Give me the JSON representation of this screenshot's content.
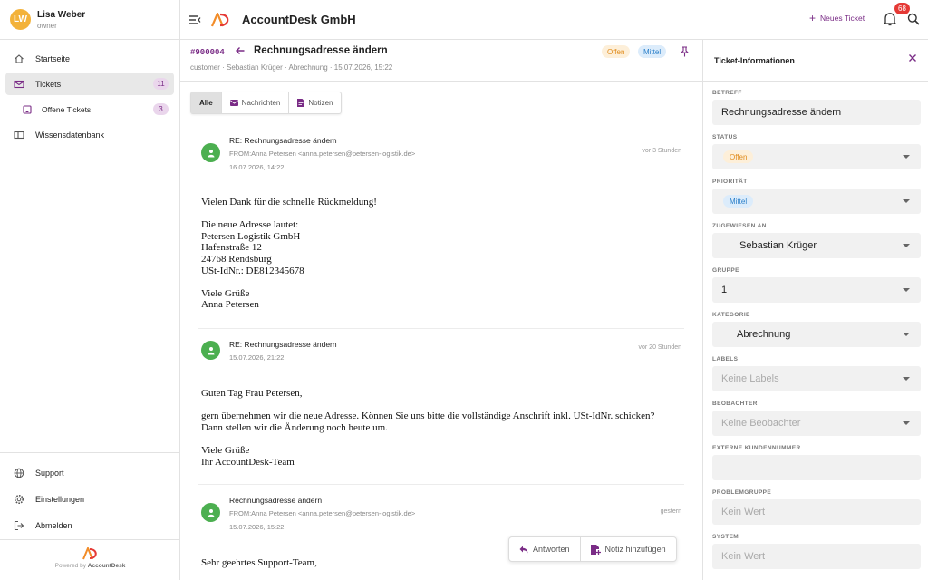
{
  "user": {
    "initials": "LW",
    "name": "Lisa Weber",
    "role": "owner"
  },
  "nav": {
    "home": "Startseite",
    "tickets": "Tickets",
    "tickets_count": "11",
    "open_tickets": "Offene Tickets",
    "open_tickets_count": "3",
    "knowledge": "Wissensdatenbank",
    "support": "Support",
    "settings": "Einstellungen",
    "logout": "Abmelden"
  },
  "powered_by": {
    "prefix": "Powered by",
    "brand": "AccountDesk"
  },
  "topbar": {
    "company": "AccountDesk GmbH",
    "new_ticket": "Neues Ticket",
    "notification_count": "68"
  },
  "ticket": {
    "id": "#900004",
    "title": "Rechnungsadresse ändern",
    "meta": "customer · Sebastian Krüger · Abrechnung · 15.07.2026, 15:22",
    "status": "Offen",
    "priority": "Mittel"
  },
  "tabs": {
    "all": "Alle",
    "messages": "Nachrichten",
    "notes": "Notizen"
  },
  "messages": [
    {
      "subject": "RE: Rechnungsadresse ändern",
      "from": "FROM:Anna Petersen <anna.petersen@petersen-logistik.de>",
      "date": "16.07.2026, 14:22",
      "ago": "vor 3 Stunden",
      "body": "Vielen Dank für die schnelle Rückmeldung!\n\nDie neue Adresse lautet:\nPetersen Logistik GmbH\nHafenstraße 12\n24768 Rendsburg\nUSt-IdNr.: DE812345678\n\nViele Grüße\nAnna Petersen"
    },
    {
      "subject": "RE: Rechnungsadresse ändern",
      "from": "",
      "date": "15.07.2026, 21:22",
      "ago": "vor 20 Stunden",
      "body": "Guten Tag Frau Petersen,\n\ngern übernehmen wir die neue Adresse. Können Sie uns bitte die vollständige Anschrift inkl. USt-IdNr. schicken?\nDann stellen wir die Änderung noch heute um.\n\nViele Grüße\nIhr AccountDesk-Team"
    },
    {
      "subject": "Rechnungsadresse ändern",
      "from": "FROM:Anna Petersen <anna.petersen@petersen-logistik.de>",
      "date": "15.07.2026, 15:22",
      "ago": "gestern",
      "body": "Sehr geehrtes Support-Team,"
    }
  ],
  "actions": {
    "reply": "Antworten",
    "add_note": "Notiz hinzufügen"
  },
  "panel": {
    "title": "Ticket-Informationen",
    "subject_label": "BETREFF",
    "subject_value": "Rechnungsadresse ändern",
    "status_label": "STATUS",
    "status_value": "Offen",
    "priority_label": "PRIORITÄT",
    "priority_value": "Mittel",
    "assignee_label": "ZUGEWIESEN AN",
    "assignee_value": "Sebastian Krüger",
    "group_label": "GRUPPE",
    "group_value": "1",
    "category_label": "KATEGORIE",
    "category_value": "Abrechnung",
    "labels_label": "LABELS",
    "labels_value": "Keine Labels",
    "watchers_label": "BEOBACHTER",
    "watchers_value": "Keine Beobachter",
    "customer_no_label": "EXTERNE KUNDENNUMMER",
    "customer_no_value": "",
    "problem_group_label": "PROBLEMGRUPPE",
    "problem_group_value": "Kein Wert",
    "system_label": "SYSTEM",
    "system_value": "Kein Wert"
  },
  "colors": {
    "accent": "#7a2c86",
    "avatar": "#f3b23a",
    "sender": "#4caf50",
    "badge": "#e53935",
    "status_open": "#e08b1a",
    "priority_mid": "#2a7fc9"
  }
}
